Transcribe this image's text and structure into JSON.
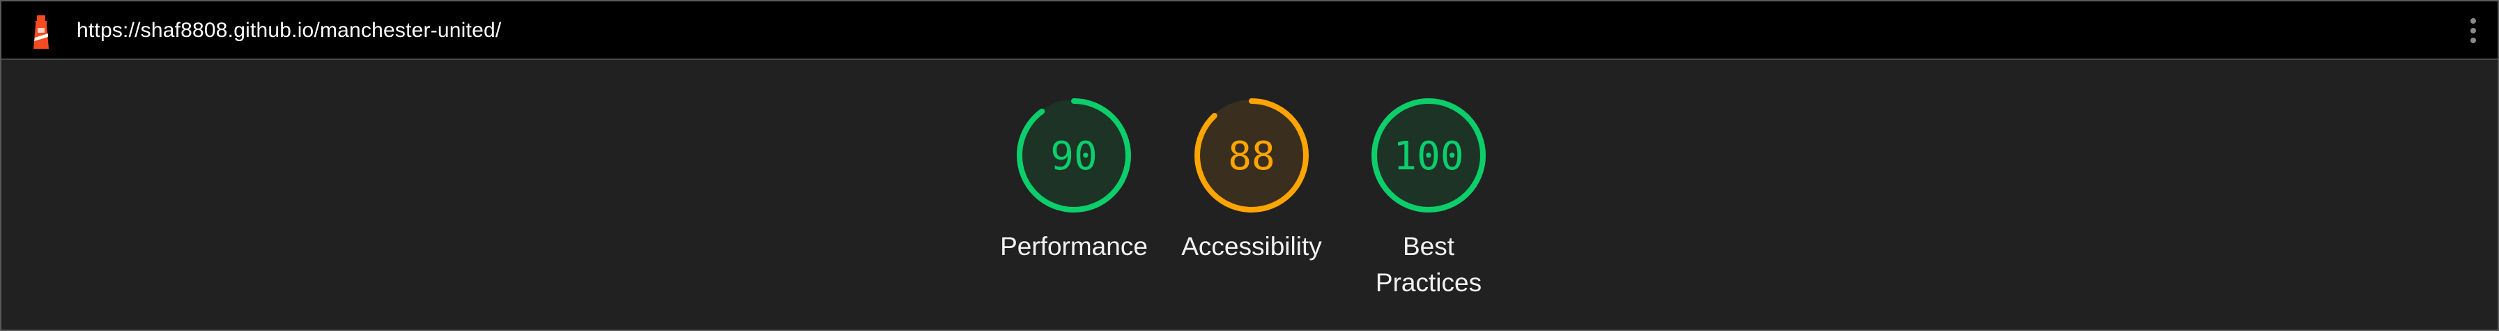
{
  "browser": {
    "url": "https://shaf8808.github.io/manchester-united/",
    "logo_icon": "lighthouse-icon",
    "menu_icon": "more-vert-icon"
  },
  "colors": {
    "pass": "#0cce6b",
    "average": "#ffa400",
    "pass_bg": "#1c3326",
    "average_bg": "#3a2f1e"
  },
  "scores": [
    {
      "label": "Performance",
      "value": "90",
      "score": 90,
      "status": "pass"
    },
    {
      "label": "Accessibility",
      "value": "88",
      "score": 88,
      "status": "average"
    },
    {
      "label_line1": "Best",
      "label_line2": "Practices",
      "value": "100",
      "score": 100,
      "status": "pass"
    }
  ]
}
